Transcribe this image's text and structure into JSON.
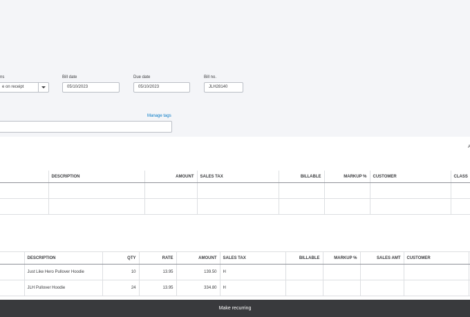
{
  "form": {
    "terms_label": "ns",
    "terms_value": "e on receipt",
    "bill_date_label": "Bill date",
    "bill_date_value": "05/10/2023",
    "due_date_label": "Due date",
    "due_date_value": "05/10/2023",
    "bill_no_label": "Bill no.",
    "bill_no_value": "JLH28140",
    "manage_tags": "Manage tags",
    "tags_value": ""
  },
  "edge_text": "A",
  "category_table": {
    "headers": [
      "",
      "DESCRIPTION",
      "AMOUNT",
      "SALES TAX",
      "BILLABLE",
      "MARKUP %",
      "CUSTOMER",
      "CLASS"
    ]
  },
  "item_table": {
    "headers": [
      "",
      "DESCRIPTION",
      "QTY",
      "RATE",
      "AMOUNT",
      "SALES TAX",
      "BILLABLE",
      "MARKUP %",
      "SALES AMT",
      "CUSTOMER",
      ""
    ],
    "rows": [
      {
        "description": "Just Like Hero Pullover Hoodie",
        "qty": "10",
        "rate": "13.95",
        "amount": "139.50",
        "sales_tax": "H"
      },
      {
        "description": "JLH Pullover Hoodie",
        "qty": "24",
        "rate": "13.95",
        "amount": "334.80",
        "sales_tax": "H"
      }
    ]
  },
  "footer": {
    "make_recurring": "Make recurring"
  }
}
